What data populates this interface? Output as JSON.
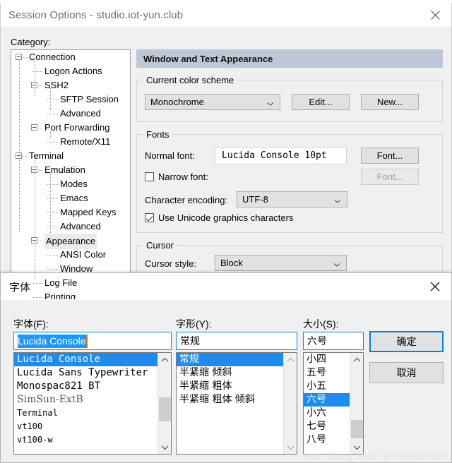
{
  "session_window": {
    "title": "Session Options - studio.iot-yun.club",
    "close_label": "✕",
    "category_label": "Category:",
    "tree": [
      {
        "label": "Connection",
        "indent": 0,
        "expander": true,
        "selected": false
      },
      {
        "label": "Logon Actions",
        "indent": 1,
        "expander": false,
        "selected": false
      },
      {
        "label": "SSH2",
        "indent": 1,
        "expander": true,
        "selected": false
      },
      {
        "label": "SFTP Session",
        "indent": 2,
        "expander": false,
        "selected": false
      },
      {
        "label": "Advanced",
        "indent": 2,
        "expander": false,
        "selected": false
      },
      {
        "label": "Port Forwarding",
        "indent": 1,
        "expander": true,
        "selected": false
      },
      {
        "label": "Remote/X11",
        "indent": 2,
        "expander": false,
        "selected": false
      },
      {
        "label": "Terminal",
        "indent": 0,
        "expander": true,
        "selected": false
      },
      {
        "label": "Emulation",
        "indent": 1,
        "expander": true,
        "selected": false
      },
      {
        "label": "Modes",
        "indent": 2,
        "expander": false,
        "selected": false
      },
      {
        "label": "Emacs",
        "indent": 2,
        "expander": false,
        "selected": false
      },
      {
        "label": "Mapped Keys",
        "indent": 2,
        "expander": false,
        "selected": false
      },
      {
        "label": "Advanced",
        "indent": 2,
        "expander": false,
        "selected": false
      },
      {
        "label": "Appearance",
        "indent": 1,
        "expander": true,
        "selected": true
      },
      {
        "label": "ANSI Color",
        "indent": 2,
        "expander": false,
        "selected": false
      },
      {
        "label": "Window",
        "indent": 2,
        "expander": false,
        "selected": false
      },
      {
        "label": "Log File",
        "indent": 1,
        "expander": false,
        "selected": false
      },
      {
        "label": "Printing",
        "indent": 1,
        "expander": false,
        "selected": false
      }
    ],
    "pane": {
      "header": "Window and Text Appearance",
      "color_scheme": {
        "group_label": "Current color scheme",
        "value": "Monochrome",
        "edit_button": "Edit...",
        "new_button": "New..."
      },
      "fonts": {
        "group_label": "Fonts",
        "normal_font_label": "Normal font:",
        "normal_font_value": "Lucida Console 10pt",
        "normal_font_button": "Font...",
        "narrow_font_label": "Narrow font:",
        "narrow_font_checked": false,
        "narrow_font_button": "Font...",
        "encoding_label": "Character encoding:",
        "encoding_value": "UTF-8",
        "unicode_graphics_label": "Use Unicode graphics characters",
        "unicode_graphics_checked": true
      },
      "cursor": {
        "group_label": "Cursor",
        "style_label": "Cursor style:",
        "style_value": "Block"
      }
    }
  },
  "font_dialog": {
    "title": "字体",
    "close_label": "✕",
    "font_label": "字体(F):",
    "font_input_value": "Lucida Console",
    "style_label": "字形(Y):",
    "style_input_value": "常规",
    "size_label": "大小(S):",
    "size_input_value": "六号",
    "font_list": [
      {
        "label": "Lucida Console",
        "style": "mono",
        "selected": true
      },
      {
        "label": "Lucida Sans Typewriter",
        "style": "mono",
        "selected": false
      },
      {
        "label": "Monospac821 BT",
        "style": "mono",
        "selected": false
      },
      {
        "label": "SimSun-ExtB",
        "style": "serif",
        "selected": false
      },
      {
        "label": "Terminal",
        "style": "term",
        "selected": false
      },
      {
        "label": "vt100",
        "style": "term",
        "selected": false
      },
      {
        "label": "vt100-w",
        "style": "term",
        "selected": false
      }
    ],
    "style_list": [
      {
        "label": "常规",
        "selected": true
      },
      {
        "label": "半紧缩 倾斜",
        "selected": false
      },
      {
        "label": "半紧缩 粗体",
        "selected": false
      },
      {
        "label": "半紧缩 粗体 倾斜",
        "selected": false
      }
    ],
    "size_list": [
      {
        "label": "小四",
        "selected": false
      },
      {
        "label": "五号",
        "selected": false
      },
      {
        "label": "小五",
        "selected": false
      },
      {
        "label": "六号",
        "selected": true
      },
      {
        "label": "小六",
        "selected": false
      },
      {
        "label": "七号",
        "selected": false
      },
      {
        "label": "八号",
        "selected": false
      }
    ],
    "ok_button": "确定",
    "cancel_button": "取消"
  },
  "watermark": "https://blog.csdn.net/NeWorld20",
  "colors": {
    "pane_header_bg": "#bdc7d8",
    "selection_blue": "#1f8ced",
    "focus_blue": "#0a7fd4",
    "dialog_bg": "#f0f0f0"
  }
}
